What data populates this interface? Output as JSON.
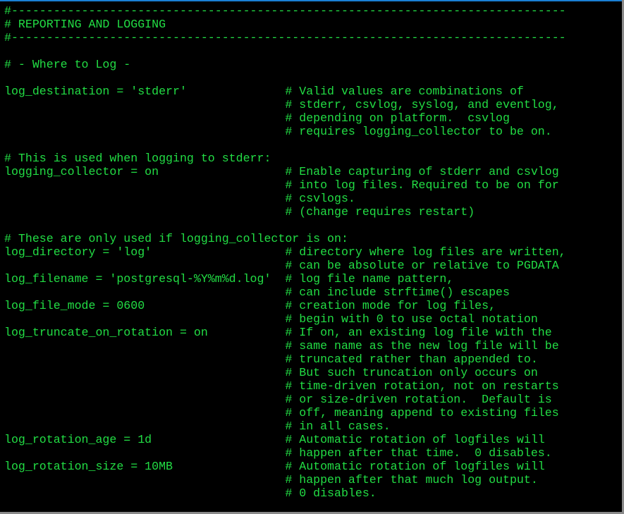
{
  "terminal": {
    "foreground": "#22dd44",
    "background": "#000000",
    "lines": [
      "#-------------------------------------------------------------------------------",
      "# REPORTING AND LOGGING",
      "#-------------------------------------------------------------------------------",
      "",
      "# - Where to Log -",
      "",
      "log_destination = 'stderr'              # Valid values are combinations of",
      "                                        # stderr, csvlog, syslog, and eventlog,",
      "                                        # depending on platform.  csvlog",
      "                                        # requires logging_collector to be on.",
      "",
      "# This is used when logging to stderr:",
      "logging_collector = on                  # Enable capturing of stderr and csvlog",
      "                                        # into log files. Required to be on for",
      "                                        # csvlogs.",
      "                                        # (change requires restart)",
      "",
      "# These are only used if logging_collector is on:",
      "log_directory = 'log'                   # directory where log files are written,",
      "                                        # can be absolute or relative to PGDATA",
      "log_filename = 'postgresql-%Y%m%d.log'  # log file name pattern,",
      "                                        # can include strftime() escapes",
      "log_file_mode = 0600                    # creation mode for log files,",
      "                                        # begin with 0 to use octal notation",
      "log_truncate_on_rotation = on           # If on, an existing log file with the",
      "                                        # same name as the new log file will be",
      "                                        # truncated rather than appended to.",
      "                                        # But such truncation only occurs on",
      "                                        # time-driven rotation, not on restarts",
      "                                        # or size-driven rotation.  Default is",
      "                                        # off, meaning append to existing files",
      "                                        # in all cases.",
      "log_rotation_age = 1d                   # Automatic rotation of logfiles will",
      "                                        # happen after that time.  0 disables.",
      "log_rotation_size = 10MB                # Automatic rotation of logfiles will",
      "                                        # happen after that much log output.",
      "                                        # 0 disables."
    ]
  }
}
